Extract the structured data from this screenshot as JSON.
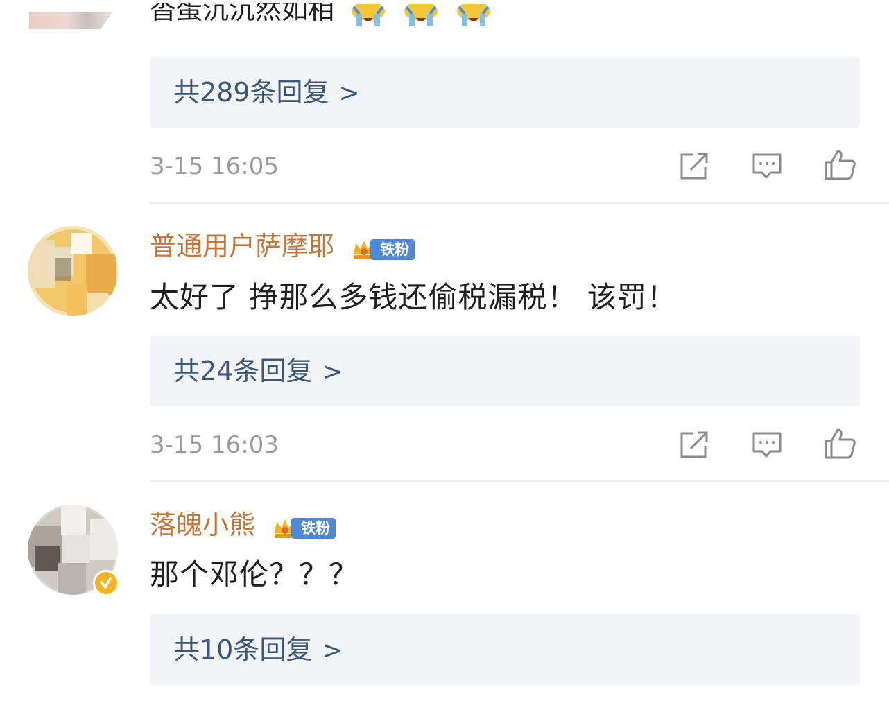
{
  "top_comment": {
    "text": "沓蛋沉沉然如相",
    "emoji_name": "cry-laugh-emoji"
  },
  "threads": [
    {
      "reply_summary": "共289条回复",
      "reply_arrow": ">",
      "timestamp": "3-15 16:05"
    },
    {
      "username": "普通用户萨摩耶",
      "badge_label": "铁粉",
      "text": "太好了 挣那么多钱还偷税漏税！ 该罚！",
      "reply_summary": "共24条回复",
      "reply_arrow": ">",
      "timestamp": "3-15 16:03"
    },
    {
      "username": "落魄小熊",
      "badge_label": "铁粉",
      "text": "那个邓伦？？？",
      "reply_summary": "共10条回复",
      "reply_arrow": ">"
    }
  ],
  "actions": {
    "icons": [
      "share-icon",
      "comment-icon",
      "like-icon"
    ]
  },
  "colors": {
    "username": "#c6773b",
    "reply_link": "#3c5878",
    "timestamp": "#9a9a9a",
    "reply_bg": "#f3f4f8",
    "badge_bg": "#4e88d6",
    "crown": "#f4b321"
  }
}
